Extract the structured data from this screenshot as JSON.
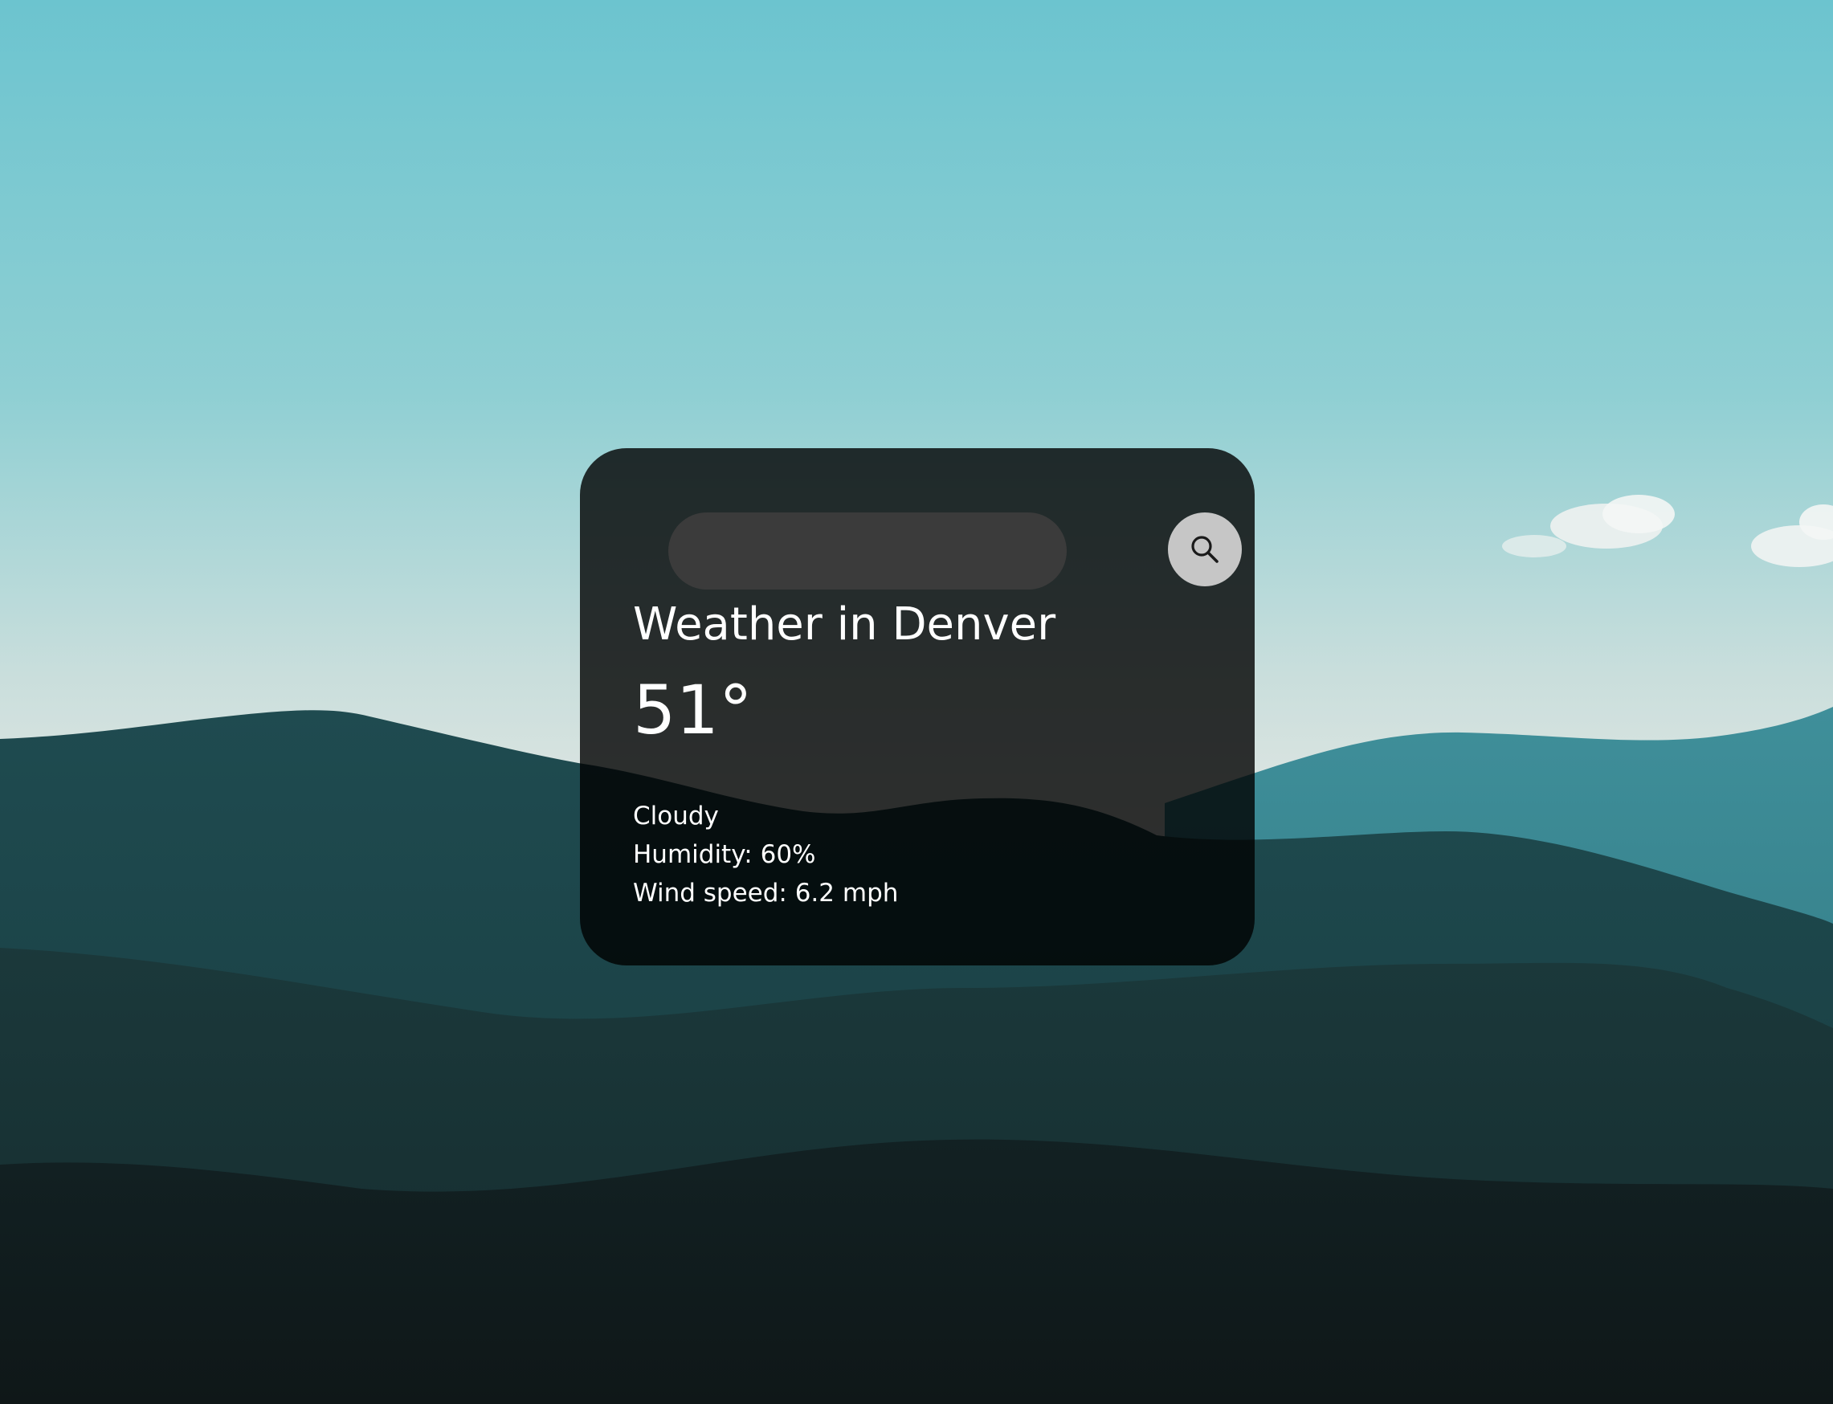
{
  "search": {
    "value": "",
    "placeholder": ""
  },
  "weather": {
    "city_heading": "Weather in Denver",
    "temperature": "51°",
    "description": "Cloudy",
    "humidity": "Humidity: 60%",
    "wind": "Wind speed: 6.2 mph"
  },
  "colors": {
    "card_background": "#1e1e1e",
    "search_field": "#3b3b3b",
    "search_button": "#c6c6c6",
    "text": "#ffffff",
    "sky_top": "#6cc4cf",
    "sky_horizon": "#dfe6e4",
    "hills": "#1d3f43"
  },
  "icons": {
    "search_button": "search-icon"
  }
}
